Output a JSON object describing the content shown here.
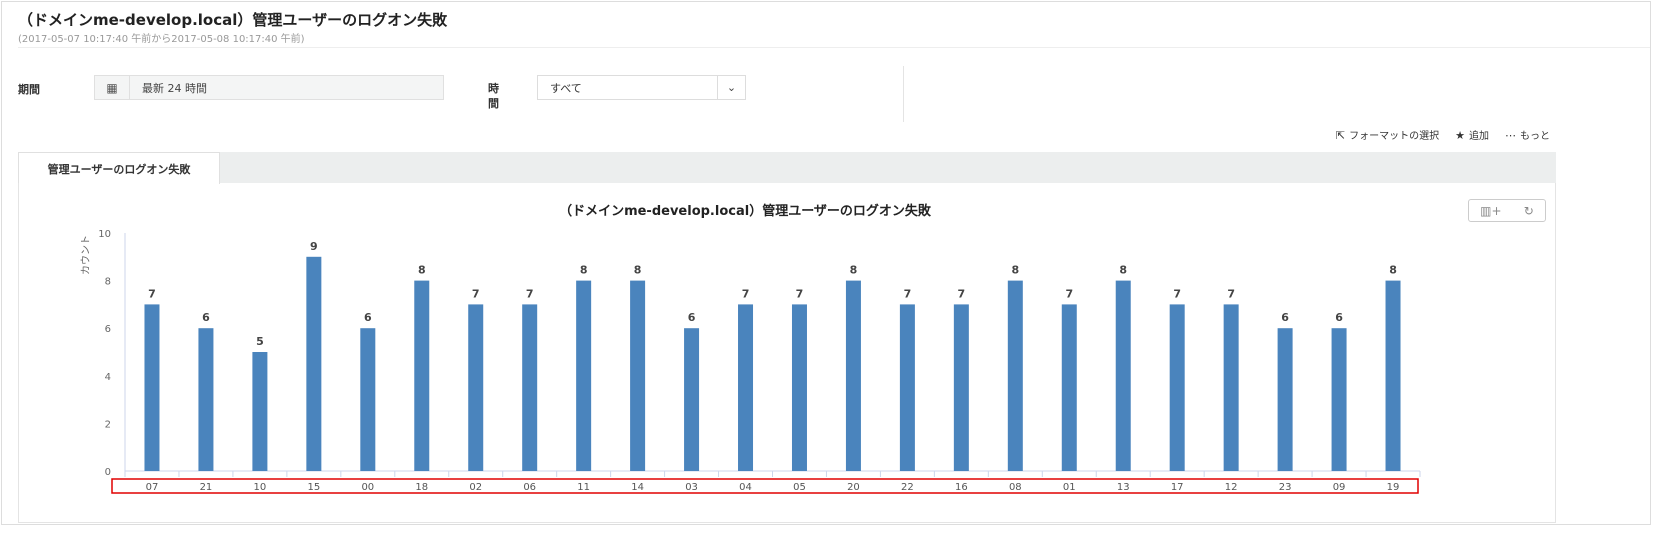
{
  "header": {
    "title": "（ドメインme-develop.local）管理ユーザーのログオン失敗",
    "subtitle": "(2017-05-07 10:17:40 午前から2017-05-08 10:17:40 午前)"
  },
  "filters": {
    "period_label": "期間",
    "period_value": "最新 24 時間",
    "time_label": "時間",
    "time_value": "すべて"
  },
  "actions": {
    "format": "フォーマットの選択",
    "add": "追加",
    "more": "もっと"
  },
  "tabs": [
    {
      "label": "管理ユーザーのログオン失敗"
    }
  ],
  "colors": {
    "bar": "#4a84bd",
    "highlight": "#e00000"
  },
  "chart_data": {
    "type": "bar",
    "title": "（ドメインme-develop.local）管理ユーザーのログオン失敗",
    "xlabel": "",
    "ylabel": "カウント",
    "ylim": [
      0,
      10
    ],
    "yticks": [
      0,
      2,
      4,
      6,
      8,
      10
    ],
    "categories": [
      "07",
      "21",
      "10",
      "15",
      "00",
      "18",
      "02",
      "06",
      "11",
      "14",
      "03",
      "04",
      "05",
      "20",
      "22",
      "16",
      "08",
      "01",
      "13",
      "17",
      "12",
      "23",
      "09",
      "19"
    ],
    "values": [
      7,
      6,
      5,
      9,
      6,
      8,
      7,
      7,
      8,
      8,
      6,
      7,
      7,
      8,
      7,
      7,
      8,
      7,
      8,
      7,
      7,
      6,
      6,
      8
    ],
    "data_labels": true,
    "grid": false
  }
}
